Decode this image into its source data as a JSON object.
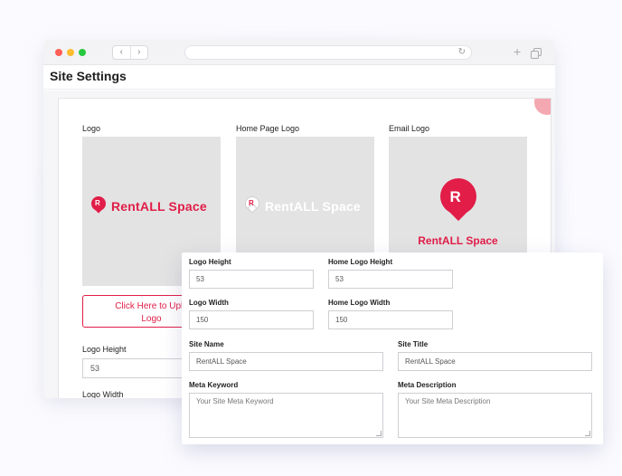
{
  "window": {
    "page_title": "Site Settings"
  },
  "logos": {
    "logo_label": "Logo",
    "home_logo_label": "Home Page Logo",
    "email_logo_label": "Email Logo",
    "brand_name": "RentALL Space",
    "upload_button_line1": "Click Here to Uplo",
    "upload_button_line2": "Logo"
  },
  "background_form": {
    "logo_height_label": "Logo Height",
    "logo_height_value": "53",
    "logo_width_label": "Logo Width"
  },
  "form": {
    "logo_height_label": "Logo Height",
    "logo_height_value": "53",
    "home_logo_height_label": "Home Logo Height",
    "home_logo_height_value": "53",
    "logo_width_label": "Logo Width",
    "logo_width_value": "150",
    "home_logo_width_label": "Home Logo Width",
    "home_logo_width_value": "150",
    "site_name_label": "Site Name",
    "site_name_value": "RentALL Space",
    "site_title_label": "Site Title",
    "site_title_value": "RentALL Space",
    "meta_keyword_label": "Meta Keyword",
    "meta_keyword_placeholder": "Your Site Meta Keyword",
    "meta_description_label": "Meta Description",
    "meta_description_placeholder": "Your Site Meta Description"
  },
  "colors": {
    "brand": "#e11d48",
    "accent_corner": "#f3a8b2"
  },
  "icons": [
    "back-icon",
    "forward-icon",
    "reload-icon",
    "new-tab-icon",
    "tabs-icon",
    "map-pin-logo-icon"
  ]
}
